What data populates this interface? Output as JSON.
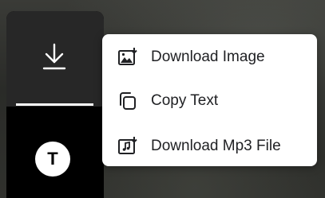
{
  "sidebar": {
    "download_icon": "download-icon",
    "avatar_letter": "T"
  },
  "menu": {
    "items": [
      {
        "label": "Download Image",
        "icon": "image-download-icon"
      },
      {
        "label": "Copy Text",
        "icon": "copy-icon"
      },
      {
        "label": "Download Mp3 File",
        "icon": "audio-file-download-icon"
      }
    ]
  },
  "colors": {
    "sidebar_bg": "#000000",
    "active_button_bg": "#272727",
    "menu_bg": "#ffffff",
    "menu_text": "#202124"
  }
}
